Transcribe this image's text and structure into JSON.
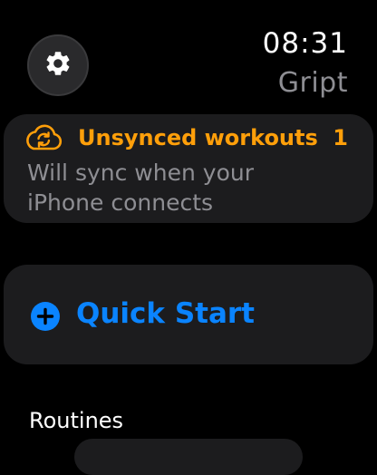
{
  "status_bar": {
    "time": "08:31",
    "app_name": "Gript",
    "settings_icon": "gear-icon"
  },
  "sync_banner": {
    "icon": "cloud-sync-icon",
    "title": "Unsynced workouts",
    "count": "1",
    "subtitle": "Will sync when your iPhone connects",
    "accent_color": "#ff9f0a"
  },
  "quick_start": {
    "icon": "plus-circle-icon",
    "label": "Quick Start",
    "accent_color": "#0a84ff"
  },
  "routines": {
    "section_title": "Routines"
  }
}
